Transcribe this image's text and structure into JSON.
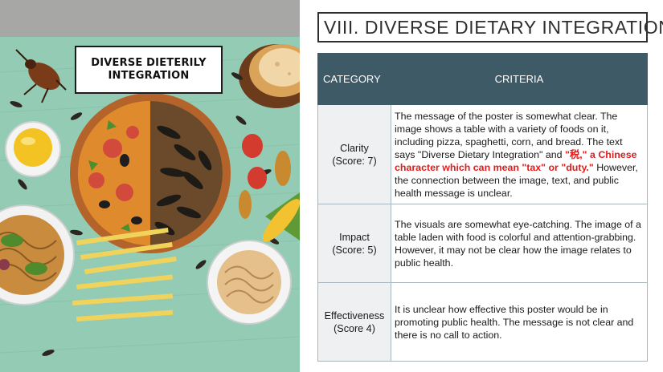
{
  "poster": {
    "title": "DIVERSE DIETERILY INTEGRATION"
  },
  "slide": {
    "title": "VIII. DIVERSE DIETARY INTEGRATION",
    "table": {
      "headers": {
        "category": "CATEGORY",
        "criteria": "CRITERIA"
      },
      "rows": [
        {
          "category": "Clarity",
          "score": "(Score: 7)",
          "criteria_before": "The message of the poster is somewhat clear. The image shows a table with a variety of foods on it, including pizza, spaghetti, corn, and bread. The text says \"Diverse Dietary Integration\" and ",
          "criteria_highlight": "\"税,\" a Chinese character which can mean \"tax\" or \"duty.\"",
          "criteria_after": " However, the connection between the image, text, and public health message is unclear."
        },
        {
          "category": "Impact",
          "score": "(Score: 5)",
          "criteria_before": "The visuals are somewhat eye-catching. The image of a table laden with food is colorful and attention-grabbing. However, it may not be clear how the image relates to public health."
        },
        {
          "category": "Effectiveness",
          "score": "(Score 4)",
          "criteria_before": "It is unclear how effective this poster would be in promoting public health. The message is not clear and there is no call to action."
        }
      ]
    }
  },
  "colors": {
    "header_bg": "#3f5a67",
    "highlight_red": "#e31b1b",
    "poster_bg": "#93cbb5"
  }
}
